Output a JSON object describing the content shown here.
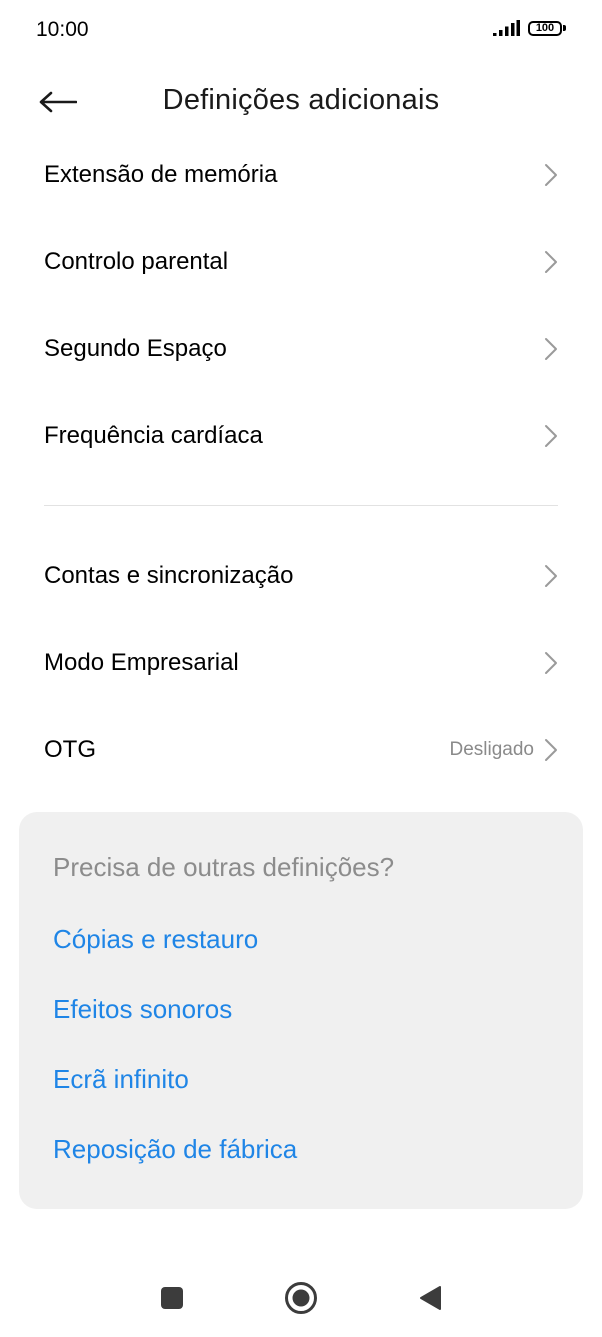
{
  "status_bar": {
    "time": "10:00",
    "battery": "100"
  },
  "header": {
    "title": "Definições adicionais",
    "back_icon": "arrow-left-icon"
  },
  "settings_group_1": [
    {
      "label": "Extensão de memória"
    },
    {
      "label": "Controlo parental"
    },
    {
      "label": "Segundo Espaço"
    },
    {
      "label": "Frequência cardíaca"
    }
  ],
  "settings_group_2": [
    {
      "label": "Contas e sincronização",
      "value": ""
    },
    {
      "label": "Modo Empresarial",
      "value": ""
    },
    {
      "label": "OTG",
      "value": "Desligado"
    }
  ],
  "suggestions": {
    "title": "Precisa de outras definições?",
    "links": [
      "Cópias e restauro",
      "Efeitos sonoros",
      "Ecrã infinito",
      "Reposição de fábrica"
    ]
  },
  "colors": {
    "link": "#1f85e6",
    "card_bg": "#f0f0f0",
    "secondary_text": "#8c8c8c"
  },
  "nav_icons": [
    "square-icon",
    "circle-icon",
    "triangle-back-icon"
  ]
}
